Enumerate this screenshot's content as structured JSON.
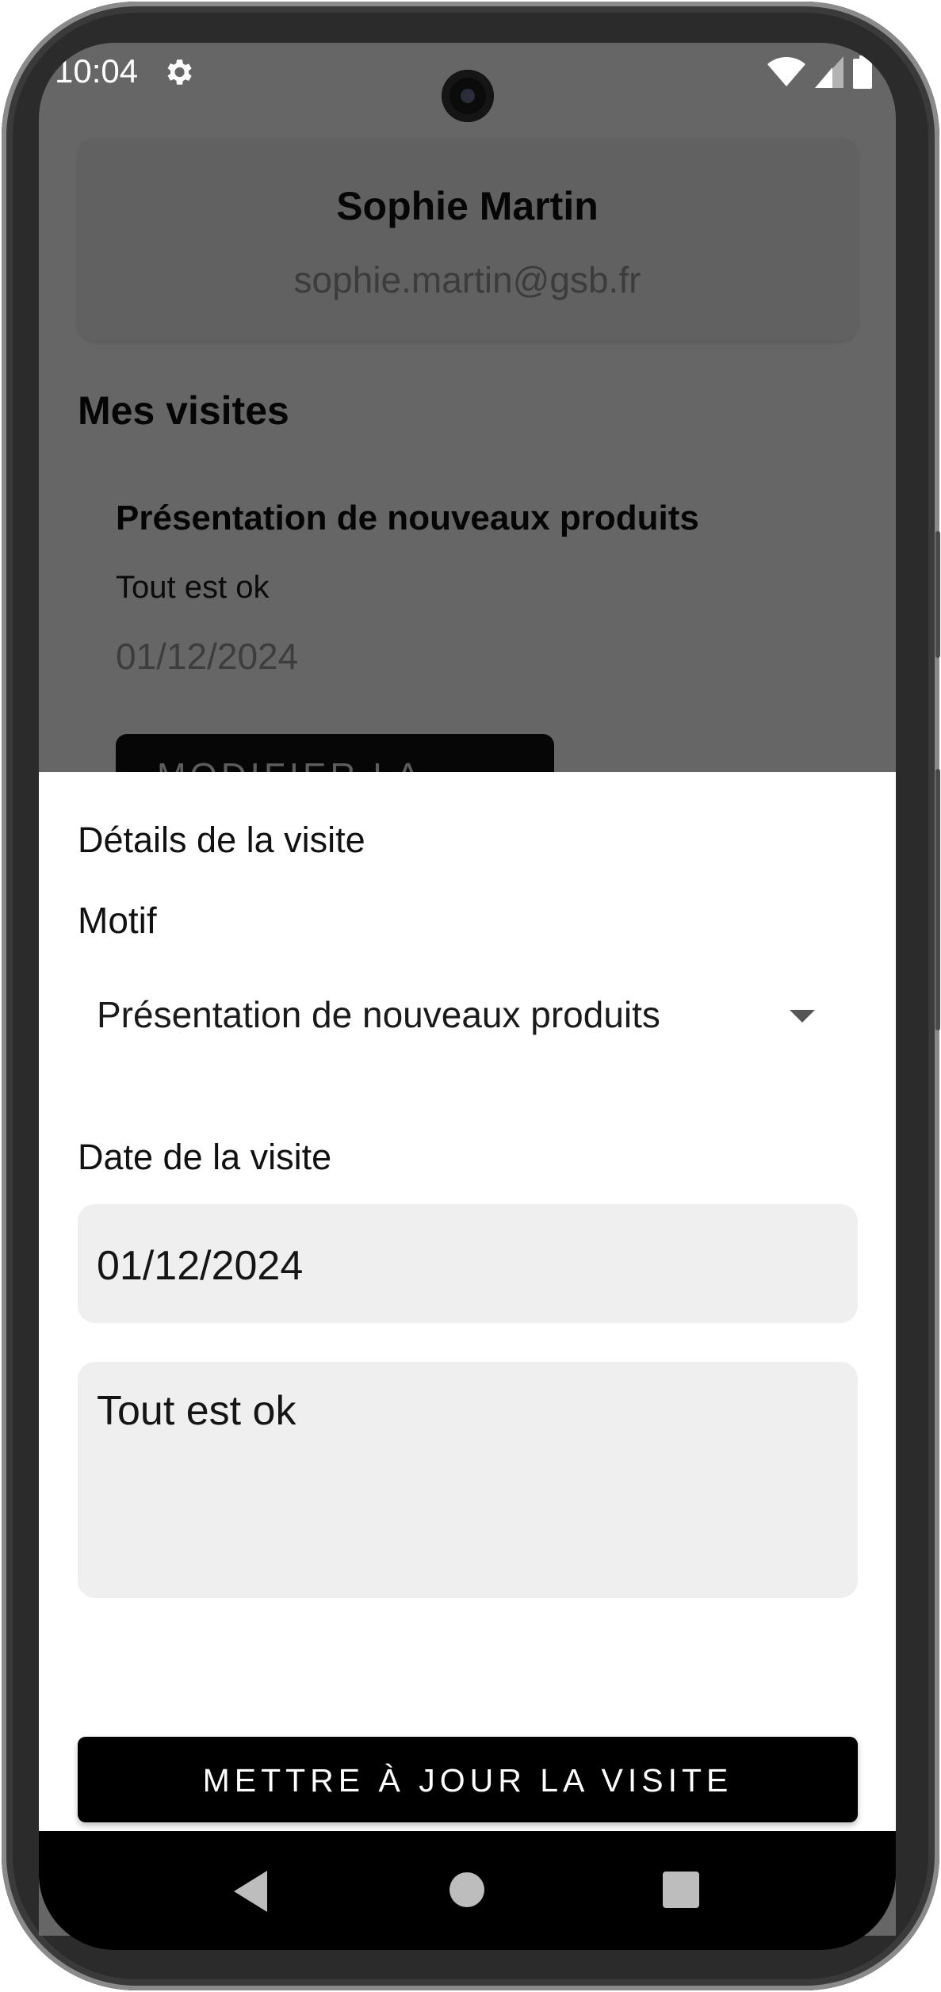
{
  "status_bar": {
    "time": "10:04",
    "icons": [
      "settings-icon",
      "wifi-icon",
      "signal-icon",
      "battery-icon"
    ]
  },
  "profile": {
    "name": "Sophie Martin",
    "email": "sophie.martin@gsb.fr"
  },
  "visits_section": {
    "title": "Mes visites",
    "visit": {
      "motif": "Présentation de nouveaux produits",
      "comment": "Tout est ok",
      "date": "01/12/2024",
      "edit_label": "MODIFIER LA VISITE"
    }
  },
  "sheet": {
    "title": "Détails de la visite",
    "motif_label": "Motif",
    "motif_value": "Présentation de nouveaux produits",
    "date_label": "Date de la visite",
    "date_value": "01/12/2024",
    "comment_value": "Tout est ok",
    "submit_label": "METTRE À JOUR LA VISITE"
  },
  "nav_bar": {
    "icons": [
      "back-icon",
      "home-icon",
      "recents-icon"
    ]
  },
  "colors": {
    "scrim": "#666666",
    "sheet_background": "#ffffff",
    "field_background": "#efefef",
    "primary_button": "#000000"
  }
}
